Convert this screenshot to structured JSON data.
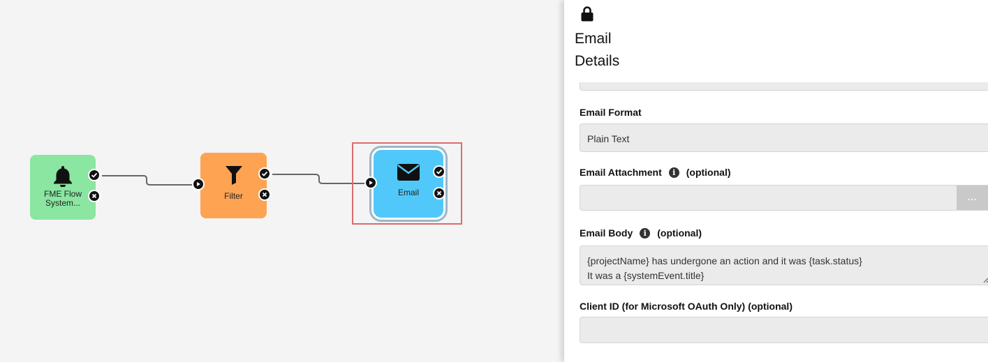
{
  "canvas": {
    "nodes": [
      {
        "label_line1": "FME Flow",
        "label_line2": "System...",
        "icon": "bell-icon",
        "color": "#8ae6a1"
      },
      {
        "label": "Filter",
        "icon": "funnel-icon",
        "color": "#fea352"
      },
      {
        "label": "Email",
        "icon": "envelope-icon",
        "color": "#50c8fa"
      }
    ],
    "port_icons": {
      "success": "check-icon",
      "failure": "x-icon",
      "input": "play-icon"
    },
    "wire_color": "#666666",
    "selection_color": "#dd6b6b"
  },
  "panel": {
    "header": {
      "lock_icon": "lock-icon",
      "title_line1": "Email",
      "title_line2": "Details"
    },
    "fields": {
      "email_format": {
        "label": "Email Format",
        "value": "Plain Text"
      },
      "email_attachment": {
        "label": "Email Attachment",
        "optional": "(optional)",
        "value": "",
        "browse": "..."
      },
      "email_body": {
        "label": "Email Body",
        "optional": "(optional)",
        "line1": "{projectName} has undergone an action and it was {task.status}",
        "line2": "It was a {systemEvent.title}"
      },
      "client_id": {
        "label": "Client ID (for Microsoft OAuth Only)",
        "optional": "(optional)",
        "value": ""
      }
    }
  }
}
